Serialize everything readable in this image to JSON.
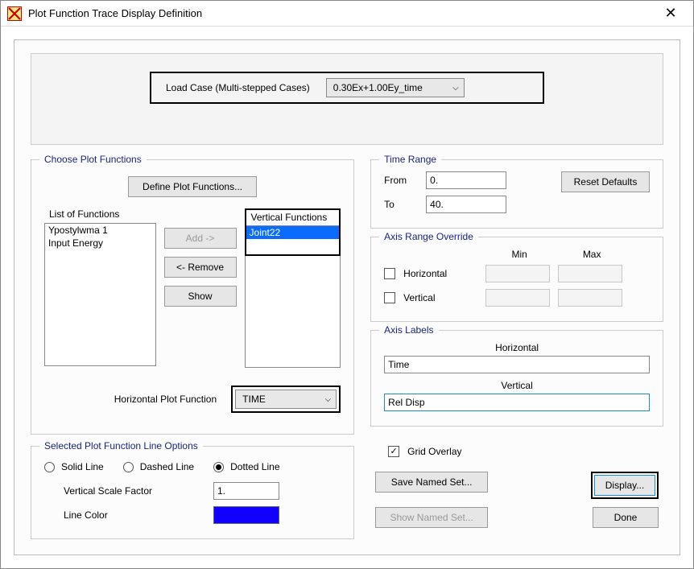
{
  "window": {
    "title": "Plot Function Trace Display Definition"
  },
  "top": {
    "load_case_label": "Load Case (Multi-stepped Cases)",
    "load_case_value": "0.30Ex+1.00Ey_time"
  },
  "choose": {
    "legend": "Choose Plot Functions",
    "define_btn": "Define Plot Functions...",
    "list_label": "List of Functions",
    "functions": [
      "Ypostylwma 1",
      "Input Energy"
    ],
    "add_btn": "Add ->",
    "remove_btn": "<- Remove",
    "show_btn": "Show",
    "vertical_label": "Vertical Functions",
    "vertical_items": [
      "Joint22"
    ],
    "horiz_label": "Horizontal Plot Function",
    "horiz_value": "TIME"
  },
  "line_opts": {
    "legend": "Selected Plot Function Line Options",
    "solid": "Solid Line",
    "dashed": "Dashed Line",
    "dotted": "Dotted Line",
    "scale_label": "Vertical  Scale Factor",
    "scale_value": "1.",
    "color_label": "Line Color",
    "color_value": "#1200ff"
  },
  "time_range": {
    "legend": "Time Range",
    "from_label": "From",
    "from_value": "0.",
    "to_label": "To",
    "to_value": "40.",
    "reset_btn": "Reset Defaults"
  },
  "axis_range": {
    "legend": "Axis Range Override",
    "min_label": "Min",
    "max_label": "Max",
    "horiz_label": "Horizontal",
    "vert_label": "Vertical"
  },
  "axis_labels": {
    "legend": "Axis Labels",
    "horiz_header": "Horizontal",
    "horiz_value": "Time",
    "vert_header": "Vertical",
    "vert_value": "Rel Disp"
  },
  "bottom": {
    "grid_label": "Grid Overlay",
    "save_btn": "Save Named Set...",
    "show_btn": "Show Named Set...",
    "display_btn": "Display...",
    "done_btn": "Done"
  }
}
